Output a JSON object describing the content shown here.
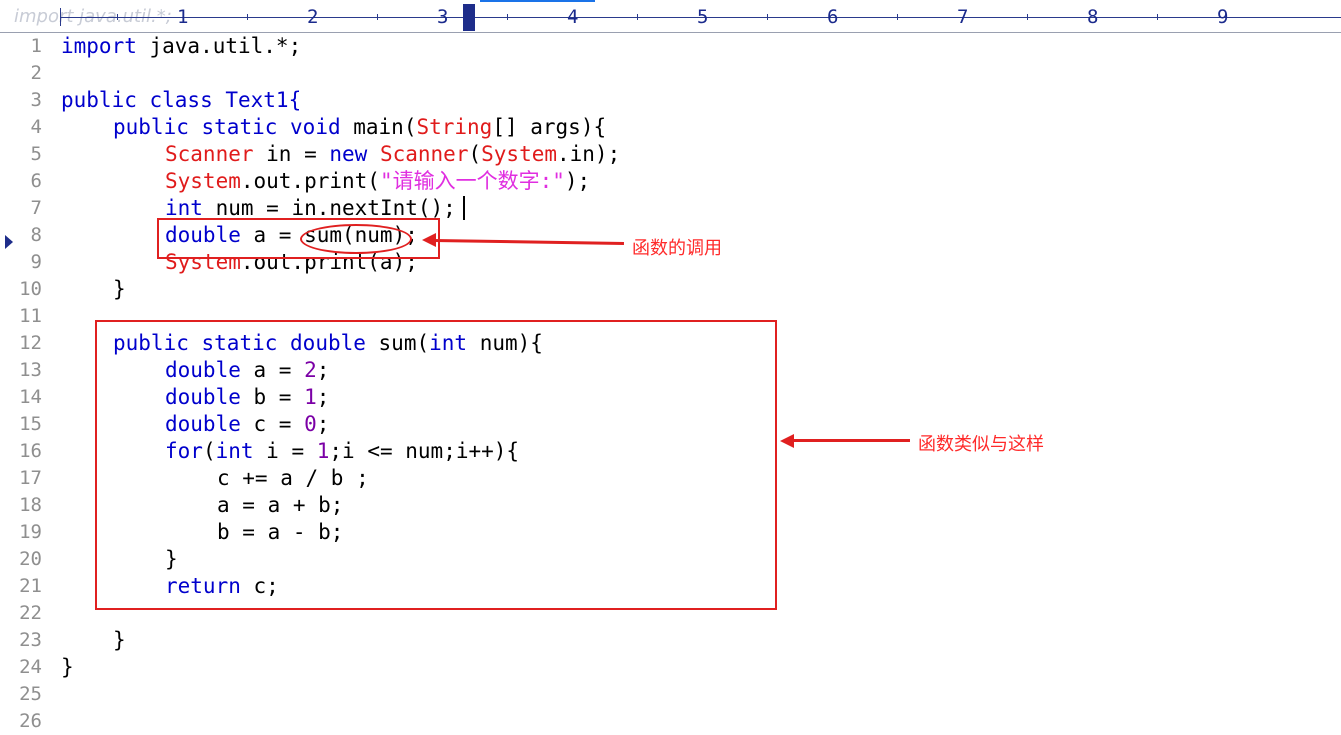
{
  "ruler": {
    "ghost_text": "import java.util.*;",
    "marks": [
      "1",
      "2",
      "3",
      "4",
      "5",
      "6",
      "7",
      "8",
      "9"
    ]
  },
  "gutter": {
    "line_numbers": [
      "1",
      "2",
      "3",
      "4",
      "5",
      "6",
      "7",
      "8",
      "9",
      "10",
      "11",
      "12",
      "13",
      "14",
      "15",
      "16",
      "17",
      "18",
      "19",
      "20",
      "21",
      "22",
      "23",
      "24",
      "25",
      "26"
    ],
    "bookmark_icon": "current-line-marker"
  },
  "code": {
    "l1_a": "import",
    "l1_b": " java.util.*;",
    "l3_a": "public class Text1{",
    "l4_kw1": "public",
    "l4_kw2": "static",
    "l4_kw3": "void",
    "l4_main": " main(",
    "l4_type": "String",
    "l4_rest": "[] args){",
    "l5_type1": "Scanner",
    "l5_mid": " in = ",
    "l5_kw": "new",
    "l5_type2": "Scanner",
    "l5_open": "(",
    "l5_type3": "System",
    "l5_rest": ".in);",
    "l6_type": "System",
    "l6_mid": ".out.print(",
    "l6_str": "\"请输入一个数字:\"",
    "l6_end": ");",
    "l7_kw": "int",
    "l7_rest": " num = in.nextInt();",
    "l8_kw": "double",
    "l8_rest": " a = sum(num);",
    "l9_type": "System",
    "l9_rest": ".out.print(a);",
    "l10": "}",
    "l12_kw1": "public",
    "l12_kw2": "static",
    "l12_kw3": "double",
    "l12_mid": " sum(",
    "l12_kw4": "int",
    "l12_rest": " num){",
    "l13_kw": "double",
    "l13_mid": " a = ",
    "l13_num": "2",
    "l13_end": ";",
    "l14_kw": "double",
    "l14_mid": " b = ",
    "l14_num": "1",
    "l14_end": ";",
    "l15_kw": "double",
    "l15_mid": " c = ",
    "l15_num": "0",
    "l15_end": ";",
    "l16_kw1": "for",
    "l16_open": "(",
    "l16_kw2": "int",
    "l16_mid": " i = ",
    "l16_num": "1",
    "l16_rest": ";i <= num;i++){",
    "l17": "c += a / b ;",
    "l18": "a = a + b;",
    "l19": "b = a - b;",
    "l20": "}",
    "l21_kw": "return",
    "l21_rest": " c;",
    "l23": "}",
    "l24": "}"
  },
  "annotations": {
    "call_note": "函数的调用",
    "function_note": "函数类似与这样",
    "accent_color": "#e02020"
  },
  "colors": {
    "keyword": "#0000cc",
    "type": "#e01b1b",
    "string": "#e02ee0",
    "number": "#7b00a6",
    "line_number": "#8f8f8f"
  }
}
